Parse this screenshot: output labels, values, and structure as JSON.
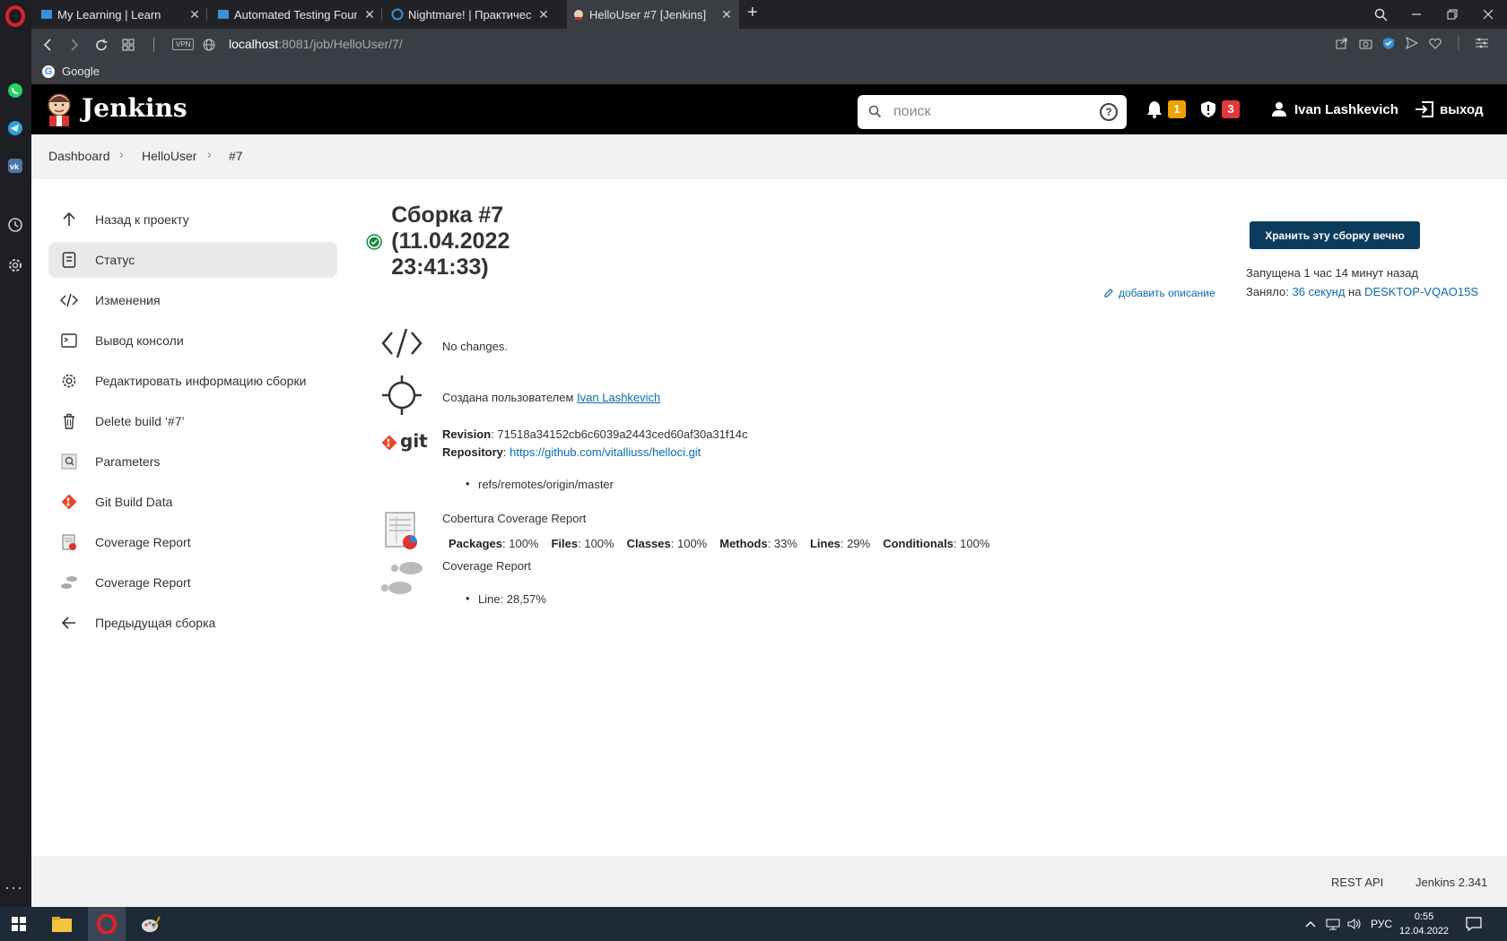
{
  "browser": {
    "tabs": [
      {
        "title": "My Learning | Learn",
        "active": false
      },
      {
        "title": "Automated Testing Founda",
        "active": false
      },
      {
        "title": "Nightmare! | Практически",
        "active": false
      },
      {
        "title": "HelloUser #7 [Jenkins]",
        "active": true
      }
    ],
    "url_host": "localhost",
    "url_path": ":8081/job/HelloUser/7/",
    "vpn_label": "VPN",
    "bookmark": "Google"
  },
  "header": {
    "title": "Jenkins",
    "search_placeholder": "поиск",
    "notifications_count": "1",
    "security_count": "3",
    "user": "Ivan Lashkevich",
    "logout": "выход",
    "colors": {
      "notif": "#f0a000",
      "security": "#e0373b"
    }
  },
  "breadcrumb": [
    "Dashboard",
    "HelloUser",
    "#7"
  ],
  "sidebar": {
    "items": [
      {
        "label": "Назад к проекту",
        "icon": "arrow-up-icon"
      },
      {
        "label": "Статус",
        "icon": "document-icon",
        "active": true
      },
      {
        "label": "Изменения",
        "icon": "code-icon"
      },
      {
        "label": "Вывод консоли",
        "icon": "terminal-icon"
      },
      {
        "label": "Редактировать информацию сборки",
        "icon": "gear-icon"
      },
      {
        "label": "Delete build ‘#7’",
        "icon": "trash-icon"
      },
      {
        "label": "Parameters",
        "icon": "parameters-icon"
      },
      {
        "label": "Git Build Data",
        "icon": "git-icon"
      },
      {
        "label": "Coverage Report",
        "icon": "cobertura-icon"
      },
      {
        "label": "Coverage Report",
        "icon": "footprints-icon"
      },
      {
        "label": "Предыдущая сборка",
        "icon": "arrow-left-icon"
      }
    ]
  },
  "build": {
    "title": "Сборка #7 (11.04.2022 23:41:33)",
    "keep_button": "Хранить эту сборку вечно",
    "started": "Запущена 1 час 14 минут назад",
    "took_prefix": "Заняло:",
    "took_duration": "36 секунд",
    "took_on": "на",
    "agent": "DESKTOP-VQAO15S",
    "add_description": "добавить описание",
    "no_changes": "No changes.",
    "created_by_prefix": "Создана пользователем",
    "created_by_user": "Ivan Lashkevich",
    "git_label": "git",
    "revision_label": "Revision",
    "revision": "71518a34152cb6c6039a2443ced60af30a31f14c",
    "repository_label": "Repository",
    "repository": "https://github.com/vitalliuss/helloci.git",
    "branch": "refs/remotes/origin/master",
    "cobertura_title": "Cobertura Coverage Report",
    "coverage_stats": [
      {
        "label": "Packages",
        "value": "100%"
      },
      {
        "label": "Files",
        "value": "100%"
      },
      {
        "label": "Classes",
        "value": "100%"
      },
      {
        "label": "Methods",
        "value": "33%"
      },
      {
        "label": "Lines",
        "value": "29%"
      },
      {
        "label": "Conditionals",
        "value": "100%"
      }
    ],
    "coverage_report_title": "Coverage Report",
    "line_coverage": "Line: 28,57%"
  },
  "footer": {
    "rest_api": "REST API",
    "version": "Jenkins 2.341"
  },
  "taskbar": {
    "lang": "РУС",
    "time": "0:55",
    "date": "12.04.2022"
  }
}
